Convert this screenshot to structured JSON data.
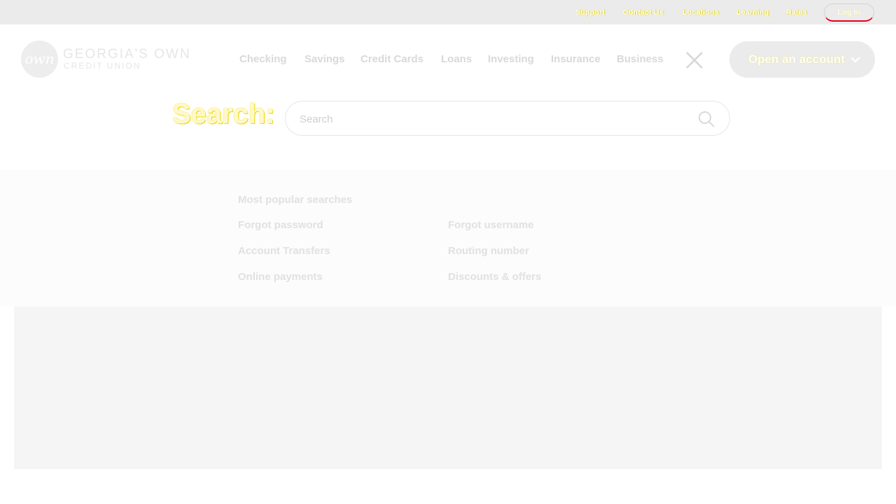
{
  "utility_nav": {
    "links": [
      "Support",
      "Contact Us",
      "Locations",
      "Learning",
      "Rates"
    ],
    "login_label": "Log In"
  },
  "logo": {
    "circle_text": "own",
    "name": "GEORGIA'S OWN",
    "subtitle": "CREDIT UNION"
  },
  "main_nav": {
    "items": [
      "Checking",
      "Savings",
      "Credit Cards",
      "Loans",
      "Investing",
      "Insurance",
      "Business"
    ],
    "close_icon": "close-icon",
    "cta_label": "Open an account",
    "cta_icon": "chevron-down-icon"
  },
  "search": {
    "heading": "Search:",
    "placeholder": "Search",
    "value": "",
    "icon": "search-icon"
  },
  "popular": {
    "heading": "Most popular searches",
    "links": [
      "Forgot password",
      "Forgot username",
      "Account Transfers",
      "Routing number",
      "Online payments",
      "Discounts & offers"
    ]
  },
  "colors": {
    "utility_bar_bg": "#ebebeb",
    "accent_yellow": "#e3d300",
    "accent_red": "#e8001c",
    "panel_bg": "#fcfcfc",
    "content_bg": "#f5f5f5"
  }
}
